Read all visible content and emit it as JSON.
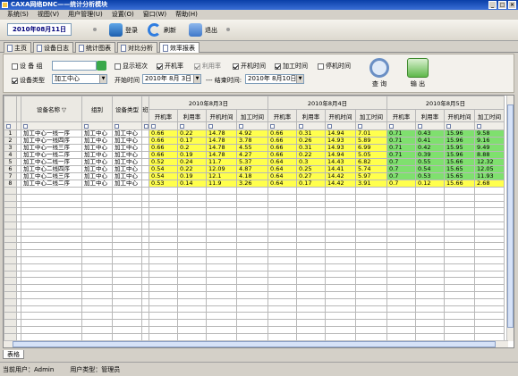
{
  "window": {
    "title": "CAXA网络DNC——统计分析模块"
  },
  "menu": [
    "系统(S)",
    "视图(V)",
    "用户管理(U)",
    "设置(O)",
    "窗口(W)",
    "帮助(H)"
  ],
  "toolbar": {
    "date": "2010年08月11日",
    "login_label": "登录",
    "refresh_label": "刷新",
    "exit_label": "退出"
  },
  "tabs": [
    "主页",
    "设备日志",
    "统计图表",
    "对比分析",
    "效率报表"
  ],
  "filters": {
    "device_group_label": "设 备 组",
    "device_type_label": "设备类型",
    "device_type_value": "加工中心",
    "show_shift_label": "显示班次",
    "start_time_label": "开始时间",
    "start_date": "2010年 8月 3日",
    "end_time_label": "--- 结束时间:",
    "end_date": "2010年 8月10日",
    "metrics": [
      "开机率",
      "利用率",
      "开机时间",
      "加工时间",
      "停机时间"
    ],
    "query_label": "查 询",
    "export_label": "输 出"
  },
  "grid": {
    "col_device_name": "设备名称",
    "col_group": "组别",
    "col_device_type": "设备类型",
    "col_truncated": "班",
    "dates": [
      "2010年8月3日",
      "2010年8月4日",
      "2010年8月5日"
    ],
    "sub_cols": [
      "开机率",
      "利用率",
      "开机时间",
      "加工时间"
    ],
    "rows": [
      {
        "num": "1",
        "name": "加工中心一线一序",
        "group": "加工中心",
        "type": "加工中心",
        "vals": [
          [
            "0.66",
            "0.22",
            "14.78",
            "4.92"
          ],
          [
            "0.66",
            "0.31",
            "14.94",
            "7.01"
          ],
          [
            "0.71",
            "0.43",
            "15.96",
            "9.58"
          ]
        ]
      },
      {
        "num": "2",
        "name": "加工中心一线四序",
        "group": "加工中心",
        "type": "加工中心",
        "vals": [
          [
            "0.66",
            "0.17",
            "14.78",
            "3.78"
          ],
          [
            "0.66",
            "0.26",
            "14.93",
            "5.89"
          ],
          [
            "0.71",
            "0.41",
            "15.96",
            "9.16"
          ]
        ]
      },
      {
        "num": "3",
        "name": "加工中心一线三序",
        "group": "加工中心",
        "type": "加工中心",
        "vals": [
          [
            "0.66",
            "0.2",
            "14.78",
            "4.55"
          ],
          [
            "0.66",
            "0.31",
            "14.93",
            "6.99"
          ],
          [
            "0.71",
            "0.42",
            "15.95",
            "9.49"
          ]
        ]
      },
      {
        "num": "4",
        "name": "加工中心一线二序",
        "group": "加工中心",
        "type": "加工中心",
        "vals": [
          [
            "0.66",
            "0.19",
            "14.78",
            "4.27"
          ],
          [
            "0.66",
            "0.22",
            "14.94",
            "5.05"
          ],
          [
            "0.71",
            "0.39",
            "15.96",
            "8.88"
          ]
        ]
      },
      {
        "num": "5",
        "name": "加工中心二线一序",
        "group": "加工中心",
        "type": "加工中心",
        "vals": [
          [
            "0.52",
            "0.24",
            "11.7",
            "5.37"
          ],
          [
            "0.64",
            "0.3",
            "14.43",
            "6.82"
          ],
          [
            "0.7",
            "0.55",
            "15.66",
            "12.32"
          ]
        ]
      },
      {
        "num": "6",
        "name": "加工中心二线四序",
        "group": "加工中心",
        "type": "加工中心",
        "vals": [
          [
            "0.54",
            "0.22",
            "12.09",
            "4.87"
          ],
          [
            "0.64",
            "0.25",
            "14.41",
            "5.74"
          ],
          [
            "0.7",
            "0.54",
            "15.65",
            "12.05"
          ]
        ]
      },
      {
        "num": "7",
        "name": "加工中心二线三序",
        "group": "加工中心",
        "type": "加工中心",
        "vals": [
          [
            "0.54",
            "0.19",
            "12.1",
            "4.18"
          ],
          [
            "0.64",
            "0.27",
            "14.42",
            "5.97"
          ],
          [
            "0.7",
            "0.53",
            "15.65",
            "11.93"
          ]
        ]
      },
      {
        "num": "8",
        "name": "加工中心二线二序",
        "group": "加工中心",
        "type": "加工中心",
        "vals": [
          [
            "0.53",
            "0.14",
            "11.9",
            "3.26"
          ],
          [
            "0.64",
            "0.17",
            "14.42",
            "3.91"
          ],
          [
            "0.7",
            "0.12",
            "15.66",
            "2.68"
          ]
        ]
      }
    ],
    "row_colors": [
      "ylw",
      "ylw",
      "ylw",
      "ylw",
      "ylw",
      "ylw",
      "ylw",
      "ylw"
    ],
    "third_colors": [
      "grn",
      "grn",
      "grn",
      "grn",
      "grn",
      "grn",
      "grn",
      "ylw"
    ]
  },
  "bottom_tab": "表格",
  "status": {
    "user": "当前用户：Admin",
    "user_type": "用户类型：管理员"
  },
  "colors": {
    "title_bar": "#0a3fa8",
    "highlight_yellow": "#ffff4d",
    "highlight_green": "#7fe06e"
  }
}
